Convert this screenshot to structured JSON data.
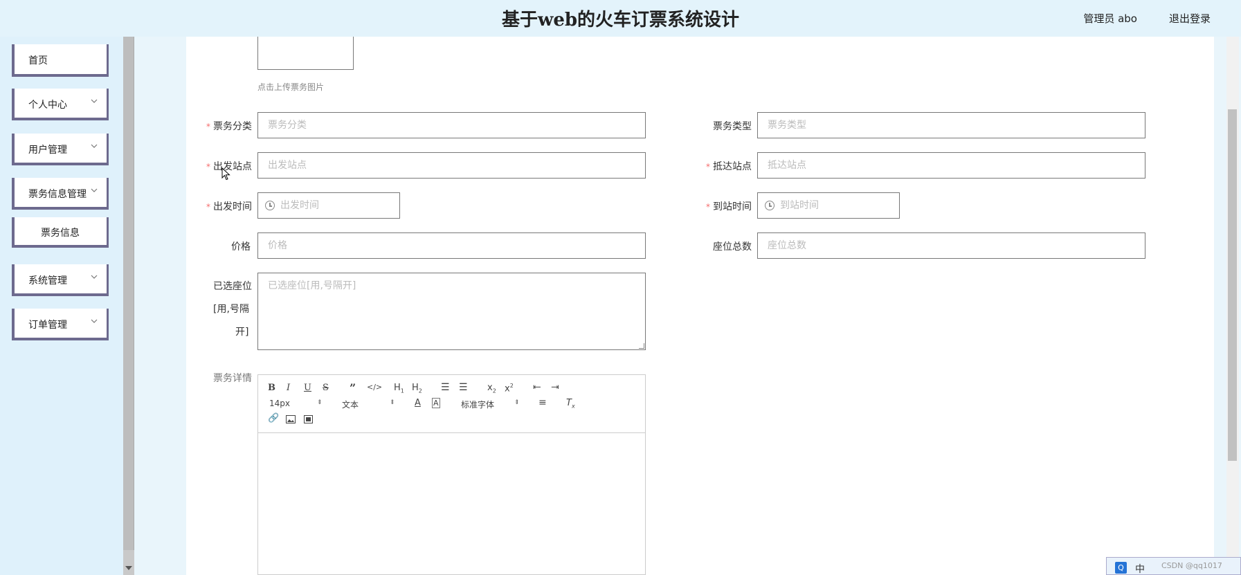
{
  "header": {
    "title": "基于web的火车订票系统设计",
    "user": "管理员 abo",
    "logout": "退出登录"
  },
  "sidebar": {
    "items": [
      {
        "label": "首页"
      },
      {
        "label": "个人中心"
      },
      {
        "label": "用户管理"
      },
      {
        "label": "票务信息管理"
      },
      {
        "label": "票务信息"
      },
      {
        "label": "系统管理"
      },
      {
        "label": "订单管理"
      }
    ]
  },
  "form": {
    "upload_hint": "点击上传票务图片",
    "category": {
      "label": "票务分类",
      "placeholder": "票务分类"
    },
    "type": {
      "label": "票务类型",
      "placeholder": "票务类型"
    },
    "from": {
      "label": "出发站点",
      "placeholder": "出发站点"
    },
    "to": {
      "label": "抵达站点",
      "placeholder": "抵达站点"
    },
    "depart_time": {
      "label": "出发时间",
      "placeholder": "出发时间"
    },
    "arrive_time": {
      "label": "到站时间",
      "placeholder": "到站时间"
    },
    "price": {
      "label": "价格",
      "placeholder": "价格"
    },
    "seats": {
      "label": "座位总数",
      "placeholder": "座位总数"
    },
    "selected_seats": {
      "label_1": "已选座位",
      "label_2": "[用,号隔",
      "label_3": "开]",
      "placeholder": "已选座位[用,号隔开]"
    },
    "details": {
      "label": "票务详情"
    }
  },
  "editor": {
    "font_size": "14px",
    "block_type": "文本",
    "font_family": "标准字体"
  },
  "tray": {
    "q": "Q",
    "zh": "中",
    "watermark": "CSDN @qq1017"
  }
}
